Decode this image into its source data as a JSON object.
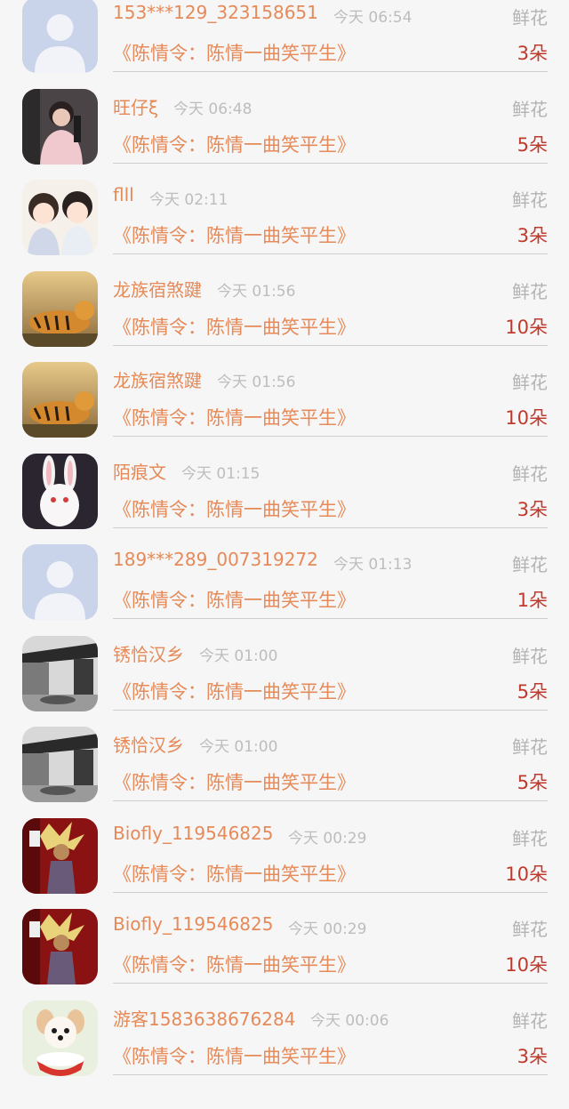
{
  "entries": [
    {
      "name": "153***129_323158651",
      "time": "今天 06:54",
      "gift": "鲜花",
      "book": "《陈情令：陈情一曲笑平生》",
      "count": "3朵",
      "avatar": "default-avatar-icon"
    },
    {
      "name": "旺仔ξ",
      "time": "今天 06:48",
      "gift": "鲜花",
      "book": "《陈情令：陈情一曲笑平生》",
      "count": "5朵",
      "avatar": "photo-girl-avatar"
    },
    {
      "name": "flll",
      "time": "今天 02:11",
      "gift": "鲜花",
      "book": "《陈情令：陈情一曲笑平生》",
      "count": "3朵",
      "avatar": "anime-pair-avatar"
    },
    {
      "name": "龙族宿煞踺",
      "time": "今天 01:56",
      "gift": "鲜花",
      "book": "《陈情令：陈情一曲笑平生》",
      "count": "10朵",
      "avatar": "tiger-avatar"
    },
    {
      "name": "龙族宿煞踺",
      "time": "今天 01:56",
      "gift": "鲜花",
      "book": "《陈情令：陈情一曲笑平生》",
      "count": "10朵",
      "avatar": "tiger-avatar"
    },
    {
      "name": "陌痕文",
      "time": "今天 01:15",
      "gift": "鲜花",
      "book": "《陈情令：陈情一曲笑平生》",
      "count": "3朵",
      "avatar": "rabbit-avatar"
    },
    {
      "name": "189***289_007319272",
      "time": "今天 01:13",
      "gift": "鲜花",
      "book": "《陈情令：陈情一曲笑平生》",
      "count": "1朵",
      "avatar": "default-avatar-icon"
    },
    {
      "name": "锈恰汉乡",
      "time": "今天 01:00",
      "gift": "鲜花",
      "book": "《陈情令：陈情一曲笑平生》",
      "count": "5朵",
      "avatar": "pavilion-avatar"
    },
    {
      "name": "锈恰汉乡",
      "time": "今天 01:00",
      "gift": "鲜花",
      "book": "《陈情令：陈情一曲笑平生》",
      "count": "5朵",
      "avatar": "pavilion-avatar"
    },
    {
      "name": "Biofly_119546825",
      "time": "今天 00:29",
      "gift": "鲜花",
      "book": "《陈情令：陈情一曲笑平生》",
      "count": "10朵",
      "avatar": "warrior-avatar"
    },
    {
      "name": "Biofly_119546825",
      "time": "今天 00:29",
      "gift": "鲜花",
      "book": "《陈情令：陈情一曲笑平生》",
      "count": "10朵",
      "avatar": "warrior-avatar"
    },
    {
      "name": "游客1583638676284",
      "time": "今天 00:06",
      "gift": "鲜花",
      "book": "《陈情令：陈情一曲笑平生》",
      "count": "3朵",
      "avatar": "puppy-avatar"
    }
  ],
  "colors": {
    "name": "#e58a58",
    "count": "#c0392b",
    "time": "#bdbdbd",
    "gift": "#b3b3b3"
  }
}
